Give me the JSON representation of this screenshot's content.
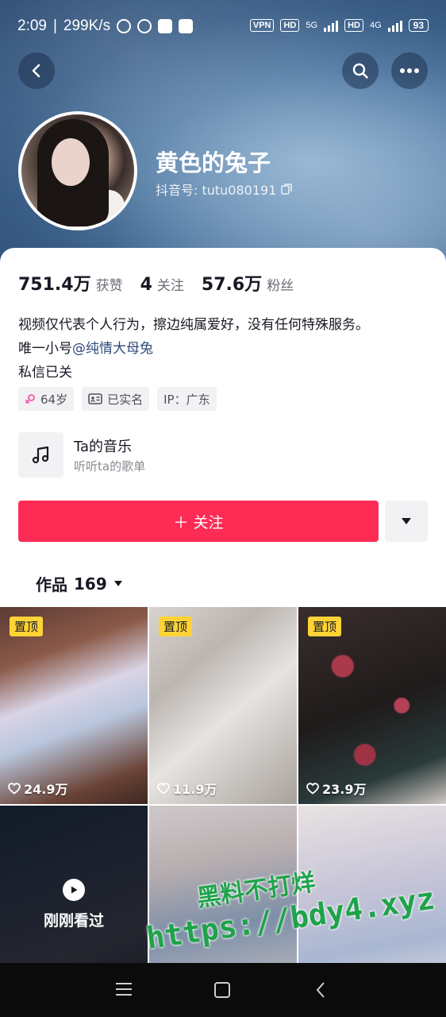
{
  "status_bar": {
    "time": "2:09",
    "speed": "299K/s",
    "vpn": "VPN",
    "hd1": "HD",
    "net1": "5G",
    "hd2": "HD",
    "net2": "4G",
    "battery": "93"
  },
  "header": {
    "nickname": "黄色的兔子",
    "handle": "抖音号: tutu080191"
  },
  "stats": [
    {
      "num": "751.4万",
      "label": "获赞"
    },
    {
      "num": "4",
      "label": "关注"
    },
    {
      "num": "57.6万",
      "label": "粉丝"
    }
  ],
  "bio": {
    "line1": "视频仅代表个人行为，擦边纯属爱好，没有任何特殊服务。",
    "line2_prefix": "唯一小号",
    "line2_mention": "@纯情大母兔",
    "line3": "私信已关"
  },
  "tags": {
    "age": "64岁",
    "verified": "已实名",
    "ip": "IP：广东"
  },
  "music": {
    "title": "Ta的音乐",
    "subtitle": "听听ta的歌单"
  },
  "actions": {
    "follow": "＋ 关注"
  },
  "tab": {
    "label": "作品",
    "count": "169"
  },
  "videos": [
    {
      "pinned": "置顶",
      "likes": "24.9万"
    },
    {
      "pinned": "置顶",
      "likes": "11.9万"
    },
    {
      "pinned": "置顶",
      "likes": "23.9万"
    },
    {
      "watched": "刚刚看过"
    },
    {},
    {}
  ],
  "watermark": {
    "line1": "黑料不打烊",
    "line2": "https://bdy4.xyz"
  }
}
